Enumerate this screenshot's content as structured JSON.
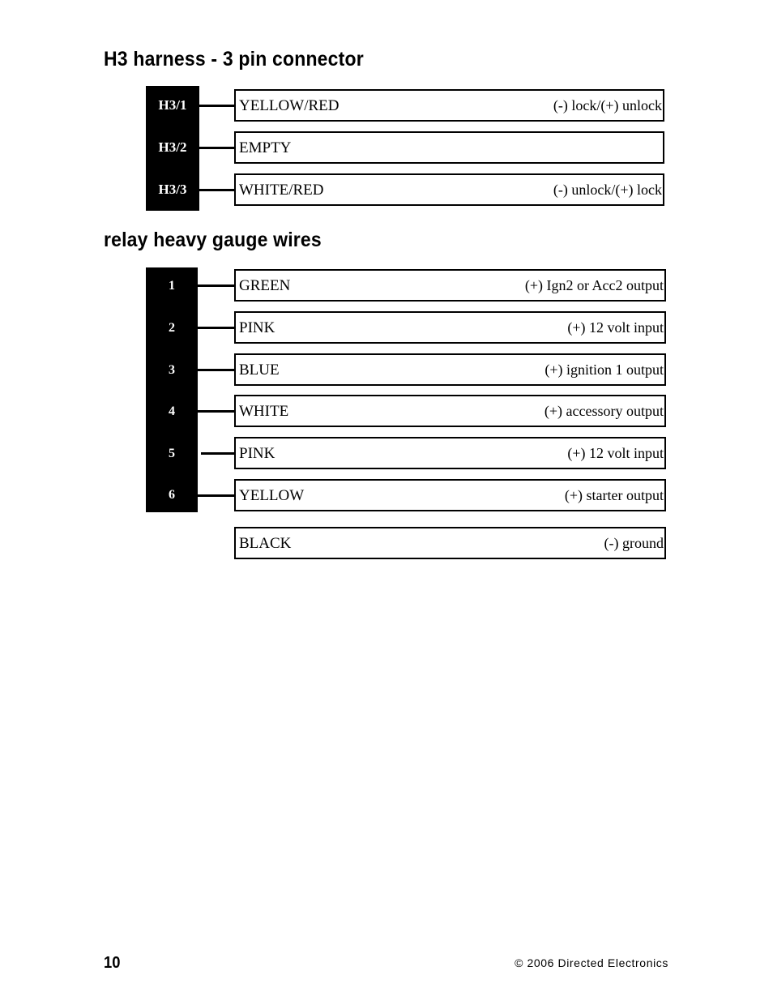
{
  "page": {
    "number": "10",
    "copyright": "© 2006 Directed Electronics",
    "background_color": "#ffffff",
    "text_color": "#000000"
  },
  "sections": [
    {
      "id": "h3-harness",
      "heading": "H3 harness - 3 pin connector",
      "connector_color": "#000000",
      "rows": [
        {
          "pin": "H3/1",
          "wire": "YELLOW/RED",
          "function": "(-) lock/(+) unlock"
        },
        {
          "pin": "H3/2",
          "wire": "EMPTY",
          "function": ""
        },
        {
          "pin": "H3/3",
          "wire": "WHITE/RED",
          "function": "(-) unlock/(+) lock"
        }
      ]
    },
    {
      "id": "relay-heavy-gauge-wires",
      "heading": "relay heavy gauge wires",
      "connector_color": "#000000",
      "rows": [
        {
          "pin": "1",
          "wire": "GREEN",
          "function": "(+) Ign2 or Acc2 output"
        },
        {
          "pin": "2",
          "wire": "PINK",
          "function": "(+) 12 volt input"
        },
        {
          "pin": "3",
          "wire": "BLUE",
          "function": "(+) ignition 1 output"
        },
        {
          "pin": "4",
          "wire": "WHITE",
          "function": "(+) accessory output"
        },
        {
          "pin": "5",
          "wire": "PINK",
          "function": "(+) 12 volt input"
        },
        {
          "pin": "6",
          "wire": "YELLOW",
          "function": "(+) starter output"
        },
        {
          "pin": "",
          "wire": "BLACK",
          "function": "(-) ground"
        }
      ]
    }
  ]
}
